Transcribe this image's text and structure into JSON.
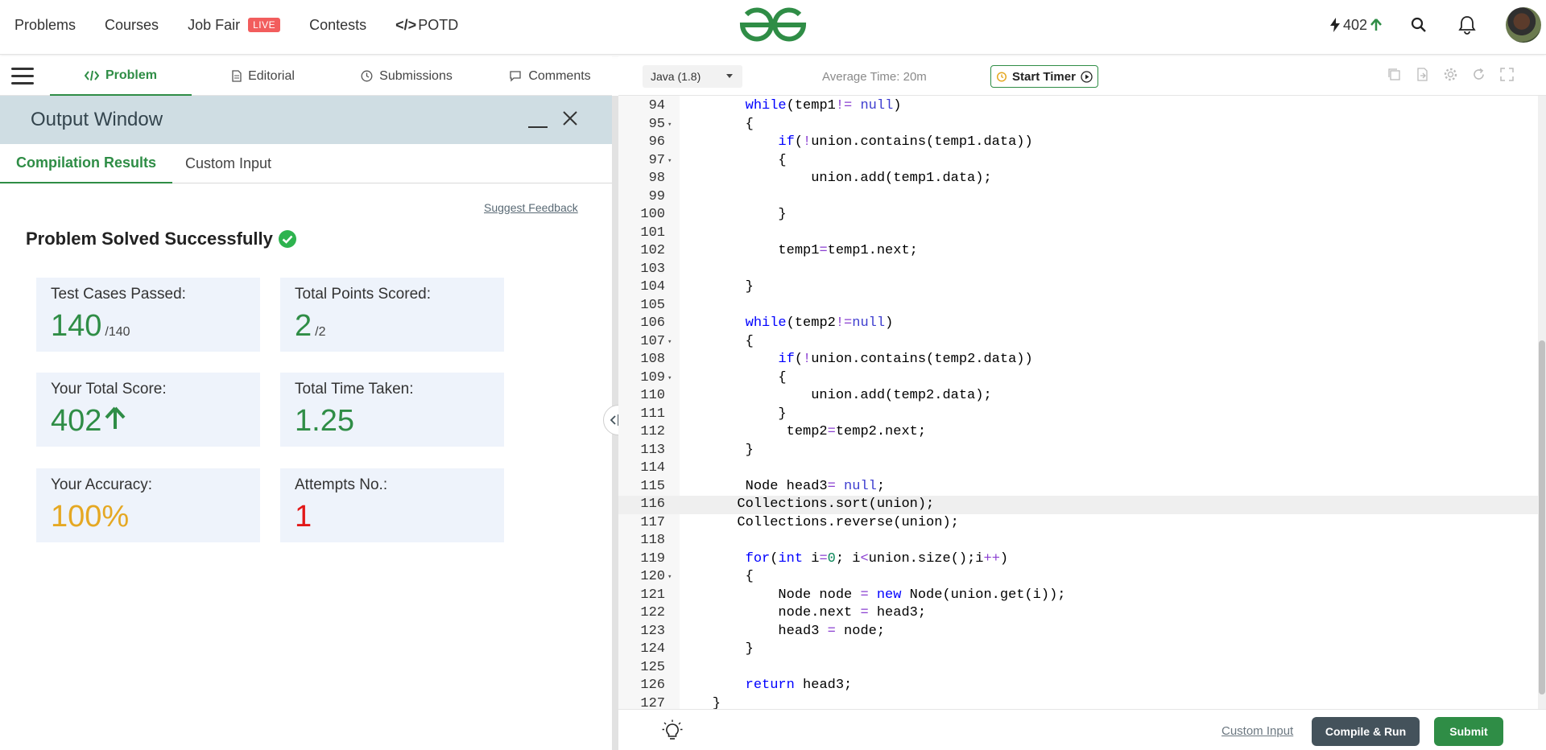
{
  "nav": {
    "items": [
      "Problems",
      "Courses",
      "Job Fair",
      "Contests"
    ],
    "live_badge": "LIVE",
    "potd_code": "</>",
    "potd_label": "POTD",
    "streak": "402"
  },
  "left_tabs": {
    "problem": "Problem",
    "editorial": "Editorial",
    "submissions": "Submissions",
    "comments": "Comments"
  },
  "output_window": {
    "title": "Output Window",
    "tabs": [
      "Compilation Results",
      "Custom Input"
    ],
    "suggest_feedback": "Suggest Feedback",
    "status": "Problem Solved Successfully",
    "cards": {
      "test_cases_label": "Test Cases Passed:",
      "test_cases_value": "140",
      "test_cases_total": "/140",
      "points_label": "Total Points Scored:",
      "points_value": "2",
      "points_total": "/2",
      "score_label": "Your Total Score:",
      "score_value": "402",
      "time_label": "Total Time Taken:",
      "time_value": "1.25",
      "accuracy_label": "Your Accuracy:",
      "accuracy_value": "100%",
      "attempts_label": "Attempts No.:",
      "attempts_value": "1"
    }
  },
  "editor": {
    "language": "Java (1.8)",
    "average_time": "Average Time: 20m",
    "start_timer": "Start Timer",
    "active_line": "116",
    "lines": [
      {
        "n": "94",
        "fold": false,
        "html": "        <span class='kw'>while</span>(temp1<span class='op'>!=</span> <span class='nul'>null</span>)"
      },
      {
        "n": "95",
        "fold": true,
        "html": "        {"
      },
      {
        "n": "96",
        "fold": false,
        "html": "            <span class='kw'>if</span>(<span class='op'>!</span>union.contains(temp1.data))"
      },
      {
        "n": "97",
        "fold": true,
        "html": "            {"
      },
      {
        "n": "98",
        "fold": false,
        "html": "                union.add(temp1.data);"
      },
      {
        "n": "99",
        "fold": false,
        "html": ""
      },
      {
        "n": "100",
        "fold": false,
        "html": "            }"
      },
      {
        "n": "101",
        "fold": false,
        "html": ""
      },
      {
        "n": "102",
        "fold": false,
        "html": "            temp1<span class='op'>=</span>temp1.next;"
      },
      {
        "n": "103",
        "fold": false,
        "html": ""
      },
      {
        "n": "104",
        "fold": false,
        "html": "        }"
      },
      {
        "n": "105",
        "fold": false,
        "html": ""
      },
      {
        "n": "106",
        "fold": false,
        "html": "        <span class='kw'>while</span>(temp2<span class='op'>!=</span><span class='nul'>null</span>)"
      },
      {
        "n": "107",
        "fold": true,
        "html": "        {"
      },
      {
        "n": "108",
        "fold": false,
        "html": "            <span class='kw'>if</span>(<span class='op'>!</span>union.contains(temp2.data))"
      },
      {
        "n": "109",
        "fold": true,
        "html": "            {"
      },
      {
        "n": "110",
        "fold": false,
        "html": "                union.add(temp2.data);"
      },
      {
        "n": "111",
        "fold": false,
        "html": "            }"
      },
      {
        "n": "112",
        "fold": false,
        "html": "             temp2<span class='op'>=</span>temp2.next;"
      },
      {
        "n": "113",
        "fold": false,
        "html": "        }"
      },
      {
        "n": "114",
        "fold": false,
        "html": ""
      },
      {
        "n": "115",
        "fold": false,
        "html": "        Node head3<span class='op'>=</span> <span class='nul'>null</span>;"
      },
      {
        "n": "116",
        "fold": false,
        "html": "       Collections.sort(union);"
      },
      {
        "n": "117",
        "fold": false,
        "html": "       Collections.reverse(union);"
      },
      {
        "n": "118",
        "fold": false,
        "html": ""
      },
      {
        "n": "119",
        "fold": false,
        "html": "        <span class='kw'>for</span>(<span class='kw'>int</span> i<span class='op'>=</span><span class='num'>0</span>; i<span class='op'>&lt;</span>union.size();i<span class='op'>++</span>)"
      },
      {
        "n": "120",
        "fold": true,
        "html": "        {"
      },
      {
        "n": "121",
        "fold": false,
        "html": "            Node node <span class='op'>=</span> <span class='kw'>new</span> Node(union.get(i));"
      },
      {
        "n": "122",
        "fold": false,
        "html": "            node.next <span class='op'>=</span> head3;"
      },
      {
        "n": "123",
        "fold": false,
        "html": "            head3 <span class='op'>=</span> node;"
      },
      {
        "n": "124",
        "fold": false,
        "html": "        }"
      },
      {
        "n": "125",
        "fold": false,
        "html": ""
      },
      {
        "n": "126",
        "fold": false,
        "html": "        <span class='kw'>return</span> head3;"
      },
      {
        "n": "127",
        "fold": false,
        "html": "    }"
      }
    ]
  },
  "bottom": {
    "custom_input": "Custom Input",
    "compile_run": "Compile & Run",
    "submit": "Submit"
  },
  "colors": {
    "brand_green": "#2f8d46",
    "accuracy_orange": "#e5a823",
    "attempts_red": "#e21818",
    "header_blue": "#cfdde3"
  }
}
